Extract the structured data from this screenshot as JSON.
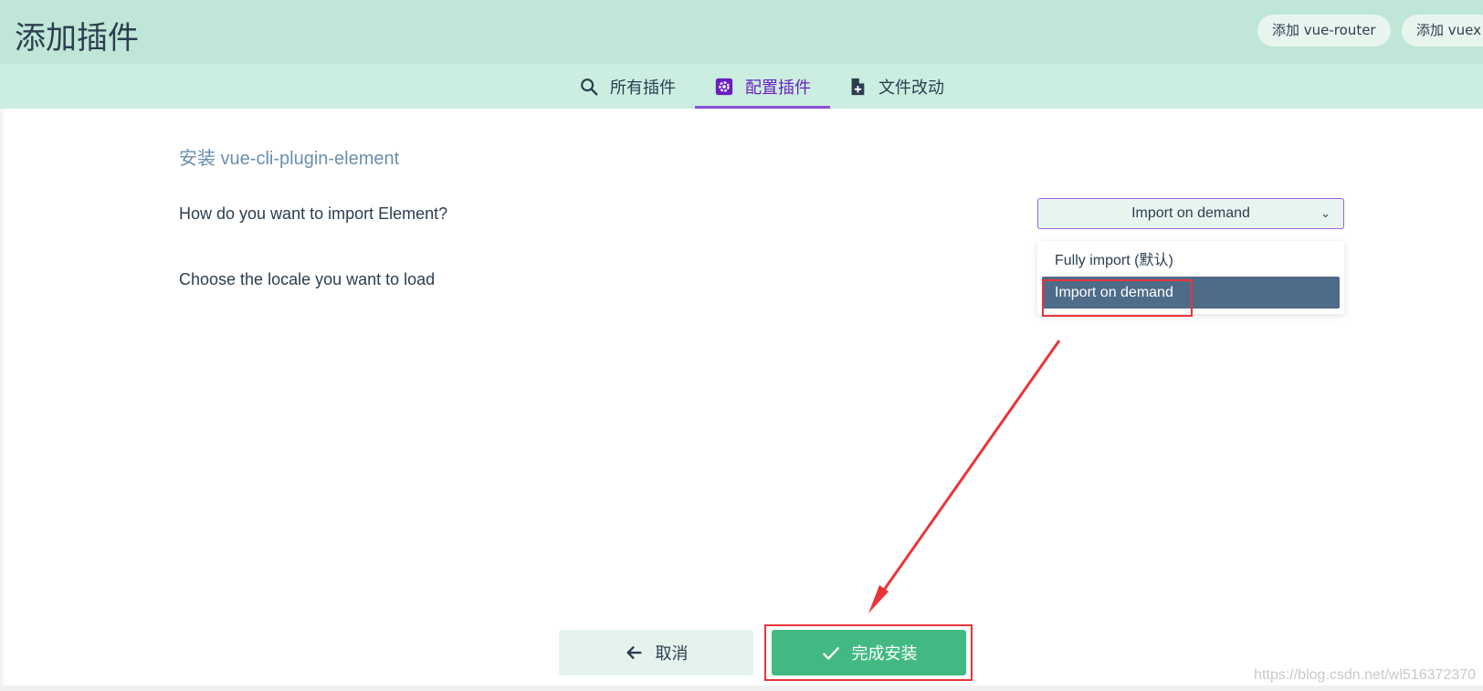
{
  "header": {
    "title": "添加插件",
    "buttons": [
      {
        "label": "添加 vue-router"
      },
      {
        "label": "添加 vuex"
      }
    ]
  },
  "tabs": [
    {
      "label": "所有插件",
      "icon": "search-icon",
      "active": false
    },
    {
      "label": "配置插件",
      "icon": "settings-icon",
      "active": true
    },
    {
      "label": "文件改动",
      "icon": "file-add-icon",
      "active": false
    }
  ],
  "main": {
    "section_title": "安装 vue-cli-plugin-element",
    "questions": [
      {
        "label": "How do you want to import Element?"
      },
      {
        "label": "Choose the locale you want to load"
      }
    ],
    "select": {
      "value": "Import on demand",
      "options": [
        "Fully import (默认)",
        "Import on demand"
      ]
    }
  },
  "footer": {
    "cancel_label": "取消",
    "finish_label": "完成安装"
  },
  "watermark": "https://blog.csdn.net/wl516372370",
  "colors": {
    "header_bg": "#bfe6d6",
    "tabbar_bg": "#cbeee0",
    "accent_purple": "#6a1fbf",
    "primary_green": "#42b983",
    "highlight_red": "#e8353a",
    "selected_option_bg": "#4f6b8a"
  }
}
